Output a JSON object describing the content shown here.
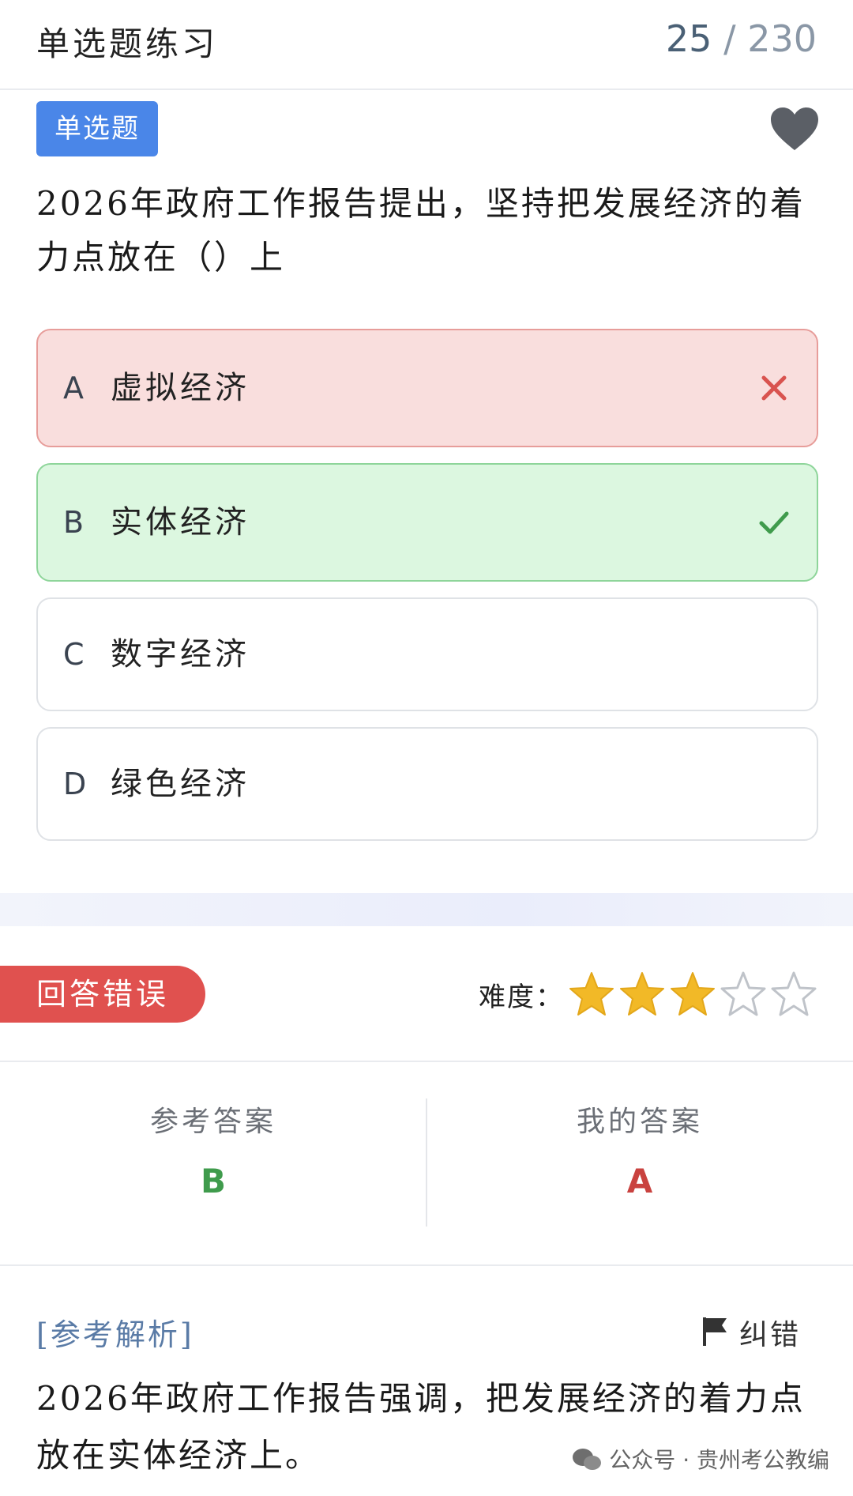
{
  "header": {
    "title": "单选题练习",
    "current": "25",
    "separator": "/",
    "total": "230"
  },
  "question": {
    "type_label": "单选题",
    "text": "2026年政府工作报告提出，坚持把发展经济的着力点放在（）上",
    "favorite_icon": "heart-icon"
  },
  "options": [
    {
      "letter": "A",
      "text": "虚拟经济",
      "state": "wrong"
    },
    {
      "letter": "B",
      "text": "实体经济",
      "state": "correct"
    },
    {
      "letter": "C",
      "text": "数字经济",
      "state": "none"
    },
    {
      "letter": "D",
      "text": "绿色经济",
      "state": "none"
    }
  ],
  "result": {
    "badge": "回答错误",
    "difficulty_label": "难度：",
    "difficulty_stars": 3,
    "difficulty_max": 5
  },
  "answers": {
    "reference_label": "参考答案",
    "reference_value": "B",
    "mine_label": "我的答案",
    "mine_value": "A"
  },
  "analysis": {
    "title": "[参考解析]",
    "report_label": "纠错",
    "text": "2026年政府工作报告强调，把发展经济的着力点放在实体经济上。"
  },
  "watermark": "公众号 · 贵州考公教编",
  "colors": {
    "badge_blue": "#4a86e8",
    "wrong_red": "#e0514f",
    "correct_green": "#3f9b4c",
    "star_gold": "#f2b927"
  }
}
